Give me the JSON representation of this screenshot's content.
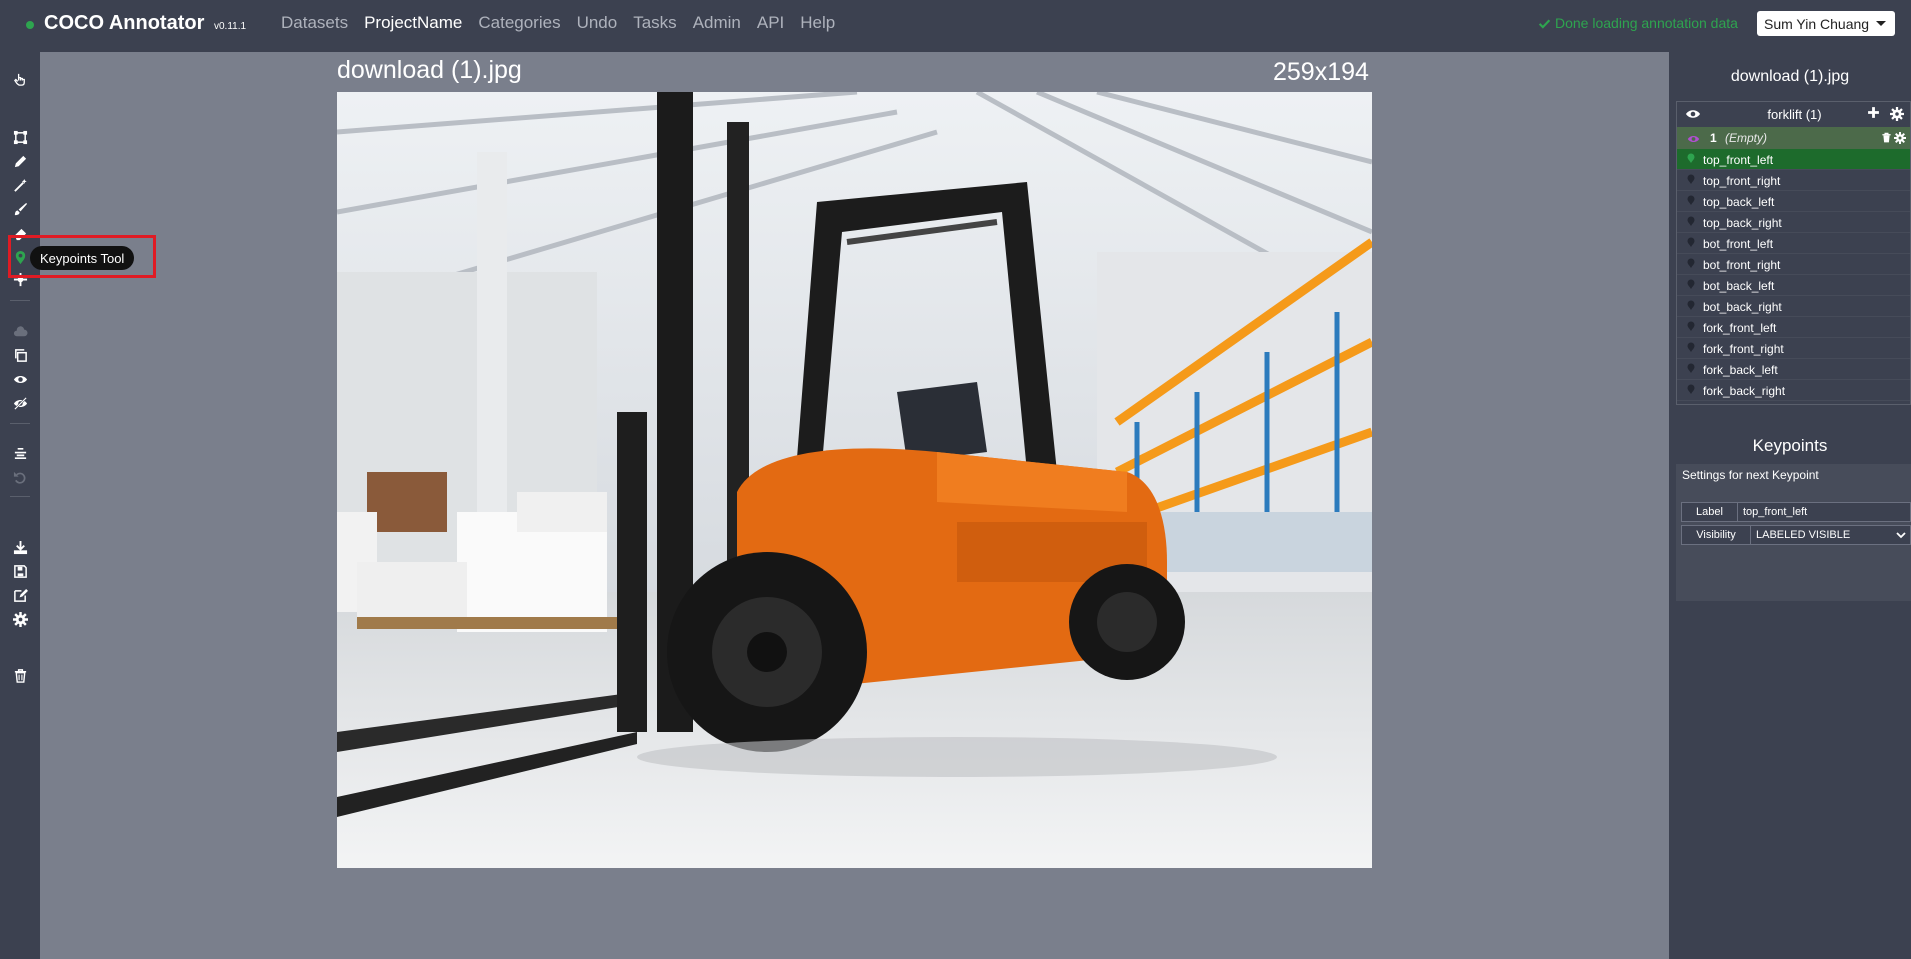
{
  "nav": {
    "brand": "COCO Annotator",
    "version": "v0.11.1",
    "links": [
      "Datasets",
      "ProjectName",
      "Categories",
      "Undo",
      "Tasks",
      "Admin",
      "API",
      "Help"
    ],
    "active_link": "ProjectName",
    "status": "Done loading annotation data",
    "user": "Sum Yin Chuang"
  },
  "toolbar": {
    "tools": [
      "select-icon",
      "bbox-icon",
      "polygon-icon",
      "magic-wand-icon",
      "brush-icon",
      "eraser-icon",
      "keypoint-icon",
      "dextr-icon",
      "cloud-icon",
      "copy-icon",
      "eye-icon",
      "eye-slash-icon",
      "align-icon",
      "undo-icon",
      "download-icon",
      "save-icon",
      "edit-icon",
      "settings-icon",
      "delete-icon"
    ],
    "tooltip": "Keypoints Tool"
  },
  "canvas": {
    "filename": "download (1).jpg",
    "dimensions": "259x194"
  },
  "sidebar": {
    "filename": "download (1).jpg",
    "category": {
      "name": "forklift (1)",
      "annotation": {
        "id": "1",
        "label": "(Empty)"
      },
      "keypoints": [
        "top_front_left",
        "top_front_right",
        "top_back_left",
        "top_back_right",
        "bot_front_left",
        "bot_front_right",
        "bot_back_left",
        "bot_back_right",
        "fork_front_left",
        "fork_front_right",
        "fork_back_left",
        "fork_back_right"
      ],
      "active_keypoint": 0
    },
    "keypoints_panel": {
      "title": "Keypoints",
      "hint": "Settings for next Keypoint",
      "label_field": "Label",
      "label_value": "top_front_left",
      "visibility_field": "Visibility",
      "visibility_value": "LABELED VISIBLE"
    }
  },
  "colors": {
    "nav_bg": "#3c4150",
    "canvas_bg": "#7a7f8c",
    "accent_green": "#2ea44f",
    "annotation_row": "#4c6a4a",
    "active_keypoint": "#1d6b2c",
    "highlight_red": "#e01b24"
  }
}
